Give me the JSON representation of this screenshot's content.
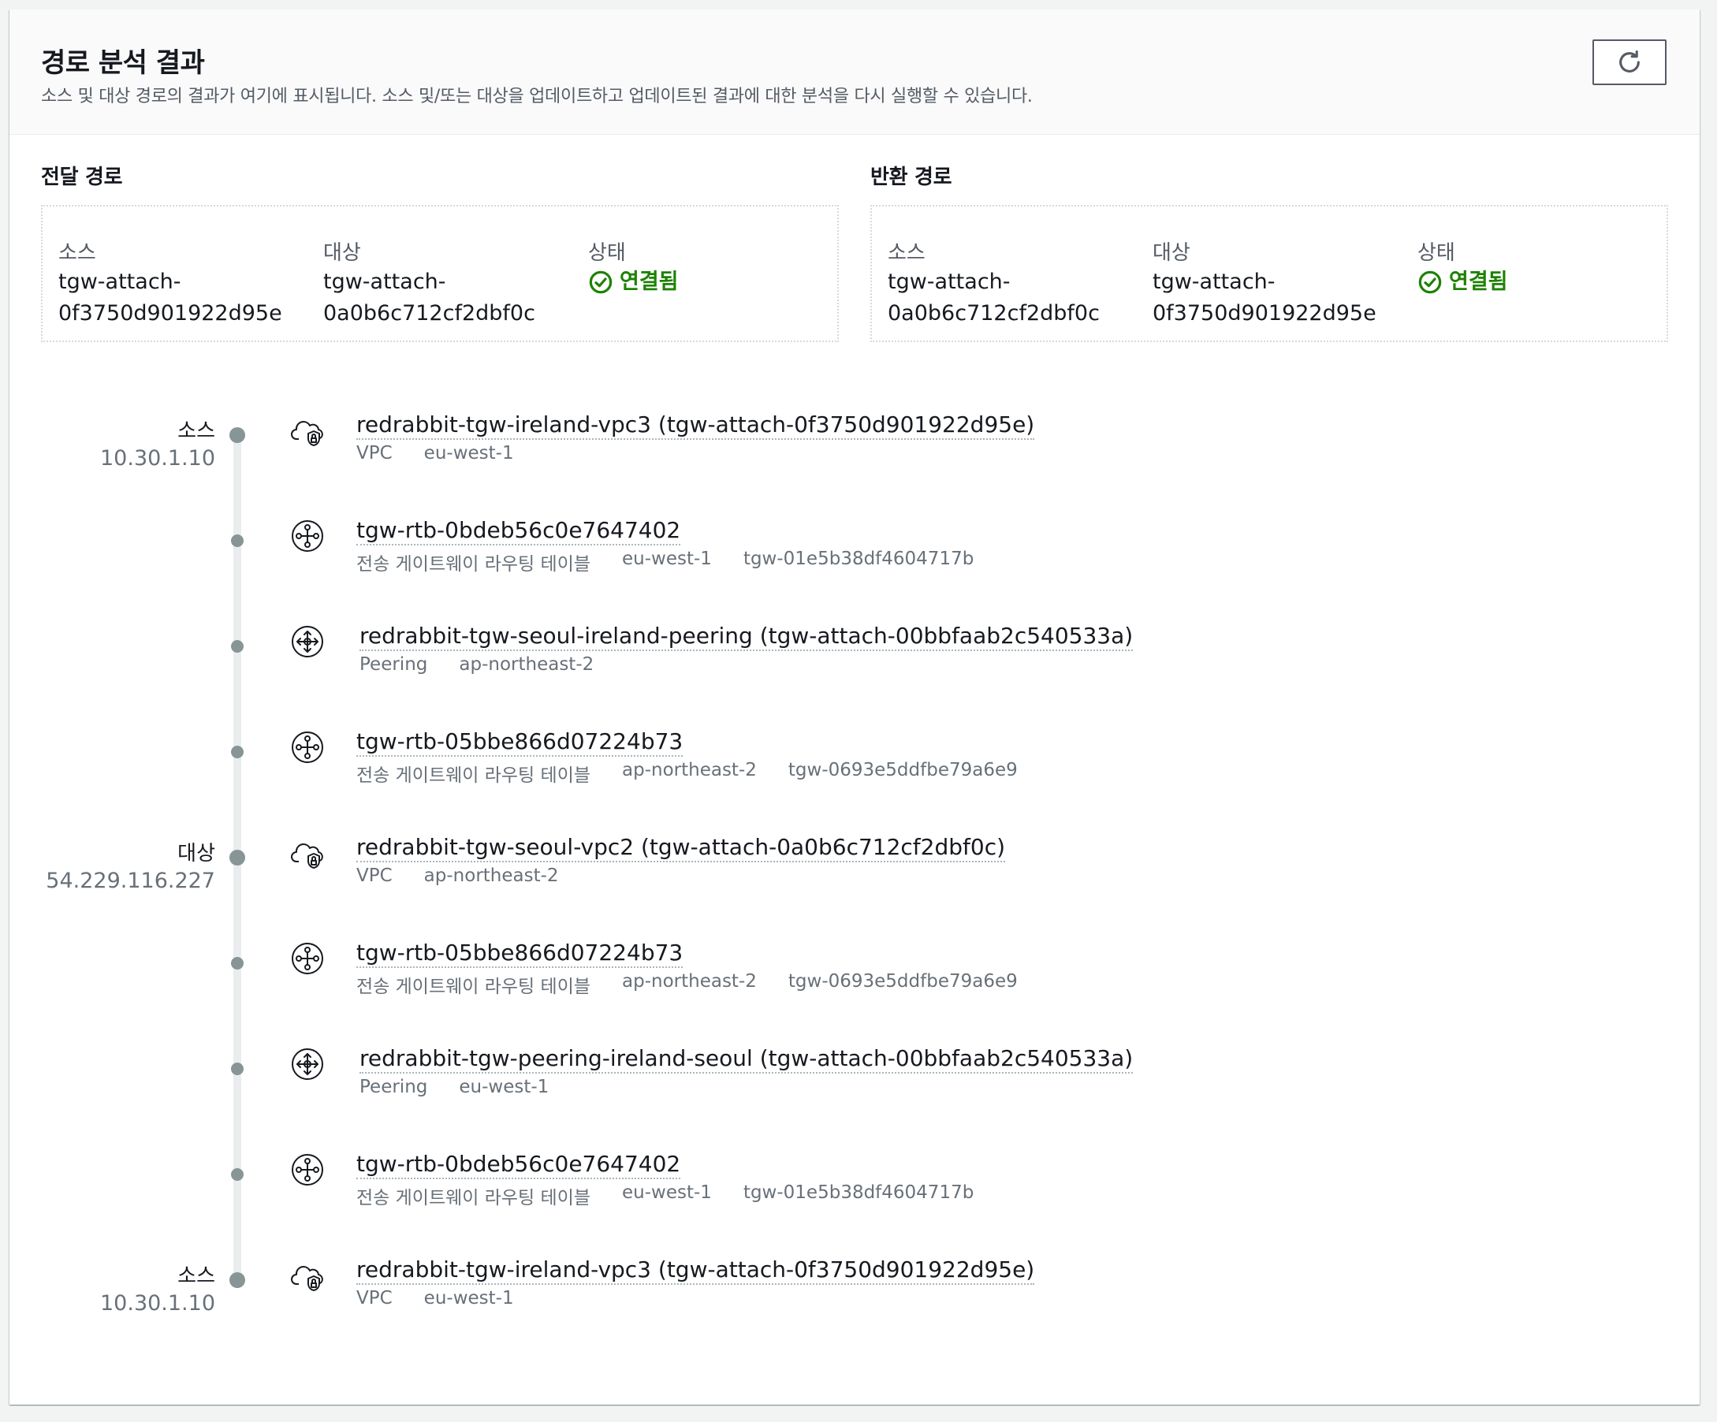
{
  "header": {
    "title": "경로 분석 결과",
    "description": "소스 및 대상 경로의 결과가 여기에 표시됩니다. 소스 및/또는 대상을 업데이트하고 업데이트된 결과에 대한 분석을 다시 실행할 수 있습니다.",
    "refresh_icon": "refresh-icon"
  },
  "forward": {
    "title": "전달 경로",
    "source_label": "소스",
    "source_value_1": "tgw-attach-",
    "source_value_2": "0f3750d901922d95e",
    "dest_label": "대상",
    "dest_value_1": "tgw-attach-",
    "dest_value_2": "0a0b6c712cf2dbf0c",
    "status_label": "상태",
    "status_value": "연결됨"
  },
  "return": {
    "title": "반환 경로",
    "source_label": "소스",
    "source_value_1": "tgw-attach-",
    "source_value_2": "0a0b6c712cf2dbf0c",
    "dest_label": "대상",
    "dest_value_1": "tgw-attach-",
    "dest_value_2": "0f3750d901922d95e",
    "status_label": "상태",
    "status_value": "연결됨"
  },
  "colors": {
    "status_ok": "#1d8102",
    "dot": "#879596"
  },
  "steps": [
    {
      "role": "소스",
      "ip": "10.30.1.10",
      "icon": "vpc-cloud-icon",
      "name": "redrabbit-tgw-ireland-vpc3 (tgw-attach-0f3750d901922d95e)",
      "meta": [
        "VPC",
        "eu-west-1"
      ]
    },
    {
      "icon": "route-table-icon",
      "name": "tgw-rtb-0bdeb56c0e7647402",
      "meta": [
        "전송 게이트웨이 라우팅 테이블",
        "eu-west-1",
        "tgw-01e5b38df4604717b"
      ]
    },
    {
      "icon": "peering-icon",
      "name": "redrabbit-tgw-seoul-ireland-peering (tgw-attach-00bbfaab2c540533a)",
      "meta": [
        "Peering",
        "ap-northeast-2"
      ]
    },
    {
      "icon": "route-table-icon",
      "name": "tgw-rtb-05bbe866d07224b73",
      "meta": [
        "전송 게이트웨이 라우팅 테이블",
        "ap-northeast-2",
        "tgw-0693e5ddfbe79a6e9"
      ]
    },
    {
      "role": "대상",
      "ip": "54.229.116.227",
      "icon": "vpc-cloud-icon",
      "name": "redrabbit-tgw-seoul-vpc2 (tgw-attach-0a0b6c712cf2dbf0c)",
      "meta": [
        "VPC",
        "ap-northeast-2"
      ]
    },
    {
      "icon": "route-table-icon",
      "name": "tgw-rtb-05bbe866d07224b73",
      "meta": [
        "전송 게이트웨이 라우팅 테이블",
        "ap-northeast-2",
        "tgw-0693e5ddfbe79a6e9"
      ]
    },
    {
      "icon": "peering-icon",
      "name": "redrabbit-tgw-peering-ireland-seoul (tgw-attach-00bbfaab2c540533a)",
      "meta": [
        "Peering",
        "eu-west-1"
      ]
    },
    {
      "icon": "route-table-icon",
      "name": "tgw-rtb-0bdeb56c0e7647402",
      "meta": [
        "전송 게이트웨이 라우팅 테이블",
        "eu-west-1",
        "tgw-01e5b38df4604717b"
      ]
    },
    {
      "role": "소스",
      "ip": "10.30.1.10",
      "icon": "vpc-cloud-icon",
      "name": "redrabbit-tgw-ireland-vpc3 (tgw-attach-0f3750d901922d95e)",
      "meta": [
        "VPC",
        "eu-west-1"
      ]
    }
  ]
}
